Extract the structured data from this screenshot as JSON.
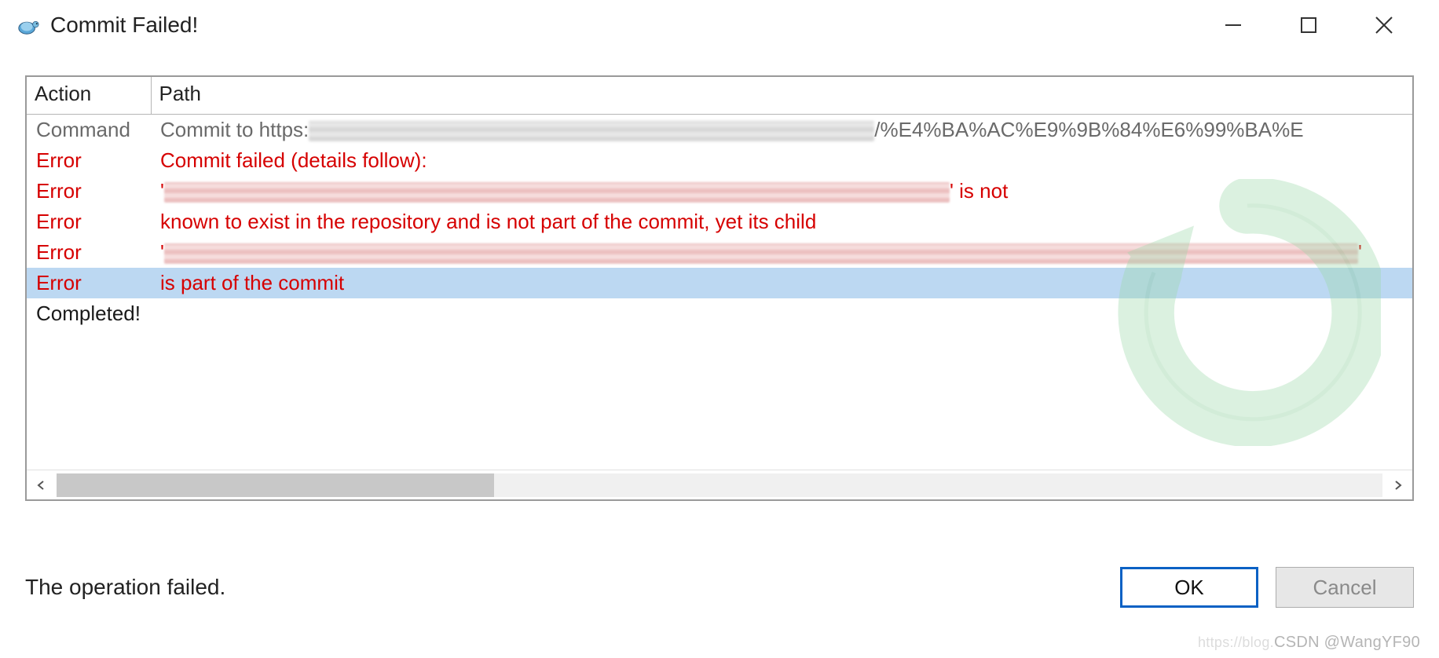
{
  "window": {
    "title": "Commit Failed!",
    "icon_name": "tortoisesvn-icon"
  },
  "table": {
    "headers": {
      "action": "Action",
      "path": "Path"
    },
    "rows": [
      {
        "type": "command",
        "action": "Command",
        "path_prefix": "Commit to https:",
        "path_suffix": "/%E4%BA%AC%E9%9B%84%E6%99%BA%E",
        "redacted_mid": true,
        "selected": false
      },
      {
        "type": "error",
        "action": "Error",
        "path": "Commit failed (details follow):",
        "selected": false
      },
      {
        "type": "error",
        "action": "Error",
        "path_prefix": "'",
        "path_suffix": "' is not",
        "redacted_mid": true,
        "selected": false
      },
      {
        "type": "error",
        "action": "Error",
        "path": " known to exist in the repository and is not part of the commit, yet its child",
        "selected": false
      },
      {
        "type": "error",
        "action": "Error",
        "path_prefix": " '",
        "path_suffix": "'",
        "redacted_full": true,
        "selected": false
      },
      {
        "type": "error",
        "action": "Error",
        "path": " is part of the commit",
        "selected": true
      },
      {
        "type": "completed",
        "action": "Completed!",
        "path": "",
        "selected": false
      }
    ]
  },
  "footer": {
    "status": "The operation failed.",
    "ok_label": "OK",
    "cancel_label": "Cancel"
  },
  "watermark": "CSDN @WangYF90",
  "watermark_prefix": "https://blog."
}
